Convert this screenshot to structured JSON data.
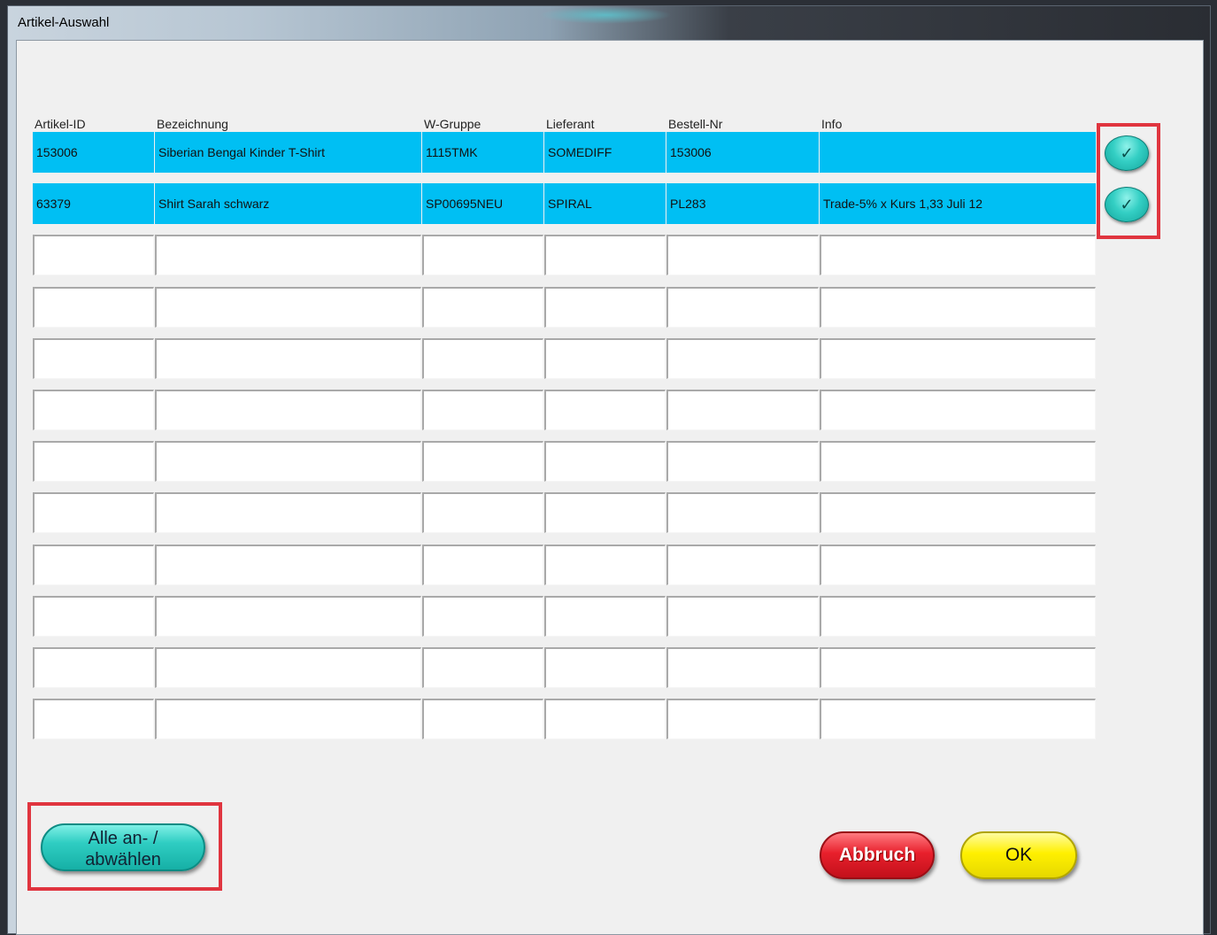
{
  "window": {
    "title": "Artikel-Auswahl"
  },
  "table": {
    "columns": [
      "Artikel-ID",
      "Bezeichnung",
      "W-Gruppe",
      "Lieferant",
      "Bestell-Nr",
      "Info"
    ],
    "rows": [
      [
        "153006",
        "Siberian  Bengal Kinder T-Shirt",
        "1115TMK",
        "SOMEDIFF",
        "153006",
        ""
      ],
      [
        "63379",
        "Shirt Sarah schwarz",
        "SP00695NEU",
        "SPIRAL",
        "PL283",
        "Trade-5% x Kurs 1,33 Juli 12"
      ],
      [
        "",
        "",
        "",
        "",
        "",
        ""
      ],
      [
        "",
        "",
        "",
        "",
        "",
        ""
      ],
      [
        "",
        "",
        "",
        "",
        "",
        ""
      ],
      [
        "",
        "",
        "",
        "",
        "",
        ""
      ],
      [
        "",
        "",
        "",
        "",
        "",
        ""
      ],
      [
        "",
        "",
        "",
        "",
        "",
        ""
      ],
      [
        "",
        "",
        "",
        "",
        "",
        ""
      ],
      [
        "",
        "",
        "",
        "",
        "",
        ""
      ],
      [
        "",
        "",
        "",
        "",
        "",
        ""
      ],
      [
        "",
        "",
        "",
        "",
        "",
        ""
      ]
    ],
    "selected_rows": [
      0,
      1
    ],
    "row_check_icon": "check-icon",
    "check_glyph": "✓"
  },
  "buttons": {
    "select_all_line1": "Alle an- /",
    "select_all_line2": "abwählen",
    "cancel": "Abbruch",
    "ok": "OK"
  },
  "colors": {
    "selected_row": "#00bff3",
    "highlight": "#e0353f",
    "cancel": "#e8202c",
    "ok": "#fff000",
    "select_all": "#2fcdc2"
  }
}
